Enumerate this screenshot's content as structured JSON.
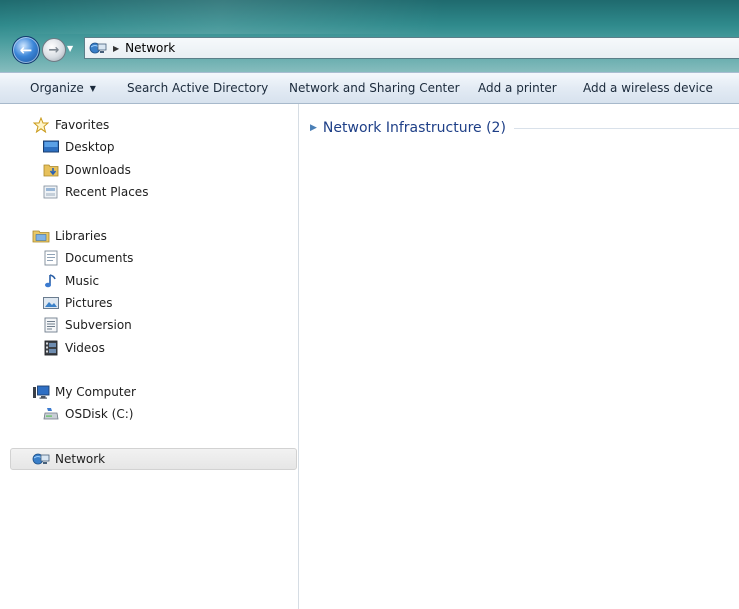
{
  "address": {
    "location": "Network"
  },
  "commands": [
    {
      "label": "Organize"
    },
    {
      "label": "Search Active Directory"
    },
    {
      "label": "Network and Sharing Center"
    },
    {
      "label": "Add a printer"
    },
    {
      "label": "Add a wireless device"
    }
  ],
  "nav": {
    "favorites": {
      "label": "Favorites",
      "items": [
        {
          "label": "Desktop"
        },
        {
          "label": "Downloads"
        },
        {
          "label": "Recent Places"
        }
      ]
    },
    "libraries": {
      "label": "Libraries",
      "items": [
        {
          "label": "Documents"
        },
        {
          "label": "Music"
        },
        {
          "label": "Pictures"
        },
        {
          "label": "Subversion"
        },
        {
          "label": "Videos"
        }
      ]
    },
    "computer": {
      "label": "My Computer",
      "items": [
        {
          "label": "OSDisk (C:)"
        }
      ]
    },
    "network": {
      "label": "Network"
    }
  },
  "content": {
    "group_title": "Network Infrastructure (2)"
  },
  "icons": {
    "back": "back-arrow-icon",
    "forward": "forward-arrow-icon",
    "network": "network-icon",
    "star": "star-icon",
    "desktop": "desktop-icon",
    "downloads": "downloads-icon",
    "recent": "recent-places-icon",
    "libraries": "libraries-icon",
    "documents": "documents-icon",
    "music": "music-icon",
    "pictures": "pictures-icon",
    "subversion": "subversion-icon",
    "videos": "videos-icon",
    "computer": "computer-icon",
    "disk": "disk-icon"
  },
  "colors": {
    "titlebar": "#2f8a8c",
    "commandbar": "#e3ebf4",
    "group_title": "#1e3f87",
    "selected": "#e6e6e6"
  }
}
